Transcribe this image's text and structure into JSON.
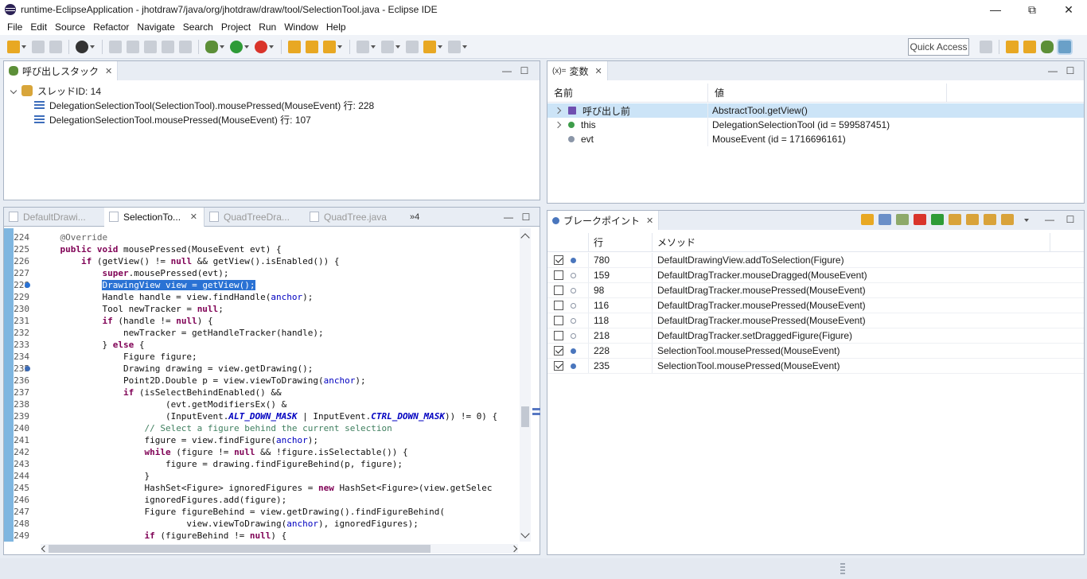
{
  "window": {
    "title": "runtime-EclipseApplication - jhotdraw7/java/org/jhotdraw/draw/tool/SelectionTool.java - Eclipse IDE",
    "minimize": "—",
    "maximize": "⧉",
    "close": "✕"
  },
  "menu": [
    "File",
    "Edit",
    "Source",
    "Refactor",
    "Navigate",
    "Search",
    "Project",
    "Run",
    "Window",
    "Help"
  ],
  "toolbar": {
    "quick_access": "Quick Access"
  },
  "debug_view": {
    "tab_label": "呼び出しスタック",
    "close": "✕",
    "minimize": "—",
    "maximize": "☐",
    "thread": "スレッドID: 14",
    "frames": [
      "DelegationSelectionTool(SelectionTool).mousePressed(MouseEvent) 行: 228",
      "DelegationSelectionTool.mousePressed(MouseEvent) 行: 107"
    ]
  },
  "variables_view": {
    "tab_label": "変数",
    "tab_prefix": "(x)=",
    "close": "✕",
    "minimize": "—",
    "maximize": "☐",
    "col_name": "名前",
    "col_value": "値",
    "rows": [
      {
        "name": "呼び出し前",
        "value": "AbstractTool.getView()",
        "icon": "return-icon",
        "expandable": true,
        "selected": true
      },
      {
        "name": "this",
        "value": "DelegationSelectionTool (id = 599587451)",
        "icon": "field-icon",
        "expandable": true,
        "selected": false
      },
      {
        "name": "evt",
        "value": "MouseEvent (id = 1716696161)",
        "icon": "local-icon",
        "expandable": false,
        "selected": false
      }
    ]
  },
  "editor": {
    "tabs": [
      {
        "label": "DefaultDrawi...",
        "active": false
      },
      {
        "label": "SelectionTo...",
        "active": true
      },
      {
        "label": "QuadTreeDra...",
        "active": false
      },
      {
        "label": "QuadTree.java",
        "active": false
      }
    ],
    "close": "✕",
    "overflow": "»4",
    "minimize": "—",
    "maximize": "☐",
    "lines": [
      {
        "n": "224",
        "html": "    <span class=\"an\">@Override</span>"
      },
      {
        "n": "225",
        "html": "    <span class=\"kw\">public</span> <span class=\"kw\">void</span> mousePressed(MouseEvent evt) {"
      },
      {
        "n": "226",
        "html": "        <span class=\"kw\">if</span> (getView() != <span class=\"kw\">null</span> &amp;&amp; getView().isEnabled()) {"
      },
      {
        "n": "227",
        "html": "            <span class=\"kw\">super</span>.mousePressed(evt);"
      },
      {
        "n": "228",
        "html": "            <span>DrawingView view = getView();</span>",
        "highlight": true,
        "bp": true
      },
      {
        "n": "229",
        "html": "            Handle handle = view.findHandle(<span class=\"fld\">anchor</span>);"
      },
      {
        "n": "230",
        "html": "            Tool newTracker = <span class=\"kw\">null</span>;"
      },
      {
        "n": "231",
        "html": "            <span class=\"kw\">if</span> (handle != <span class=\"kw\">null</span>) {"
      },
      {
        "n": "232",
        "html": "                newTracker = getHandleTracker(handle);"
      },
      {
        "n": "233",
        "html": "            } <span class=\"kw\">else</span> {"
      },
      {
        "n": "234",
        "html": "                Figure figure;"
      },
      {
        "n": "235",
        "html": "                Drawing drawing = view.getDrawing();",
        "bp": true
      },
      {
        "n": "236",
        "html": "                Point2D.Double p = view.viewToDrawing(<span class=\"fld\">anchor</span>);"
      },
      {
        "n": "237",
        "html": "                <span class=\"kw\">if</span> (isSelectBehindEnabled() &amp;&amp;"
      },
      {
        "n": "238",
        "html": "                        (evt.getModifiersEx() &amp;"
      },
      {
        "n": "239",
        "html": "                        (InputEvent.<span class=\"sfld\">ALT_DOWN_MASK</span> | InputEvent.<span class=\"sfld\">CTRL_DOWN_MASK</span>)) != 0) {"
      },
      {
        "n": "240",
        "html": "                    <span class=\"cm\">// Select a figure behind the current selection</span>"
      },
      {
        "n": "241",
        "html": "                    figure = view.findFigure(<span class=\"fld\">anchor</span>);"
      },
      {
        "n": "242",
        "html": "                    <span class=\"kw\">while</span> (figure != <span class=\"kw\">null</span> &amp;&amp; !figure.isSelectable()) {"
      },
      {
        "n": "243",
        "html": "                        figure = drawing.findFigureBehind(p, figure);"
      },
      {
        "n": "244",
        "html": "                    }"
      },
      {
        "n": "245",
        "html": "                    HashSet&lt;Figure&gt; ignoredFigures = <span class=\"kw\">new</span> HashSet&lt;Figure&gt;(view.getSelec"
      },
      {
        "n": "246",
        "html": "                    ignoredFigures.add(figure);"
      },
      {
        "n": "247",
        "html": "                    Figure figureBehind = view.getDrawing().findFigureBehind("
      },
      {
        "n": "248",
        "html": "                            view.viewToDrawing(<span class=\"fld\">anchor</span>), ignoredFigures);"
      },
      {
        "n": "249",
        "html": "                    <span class=\"kw\">if</span> (figureBehind != <span class=\"kw\">null</span>) {"
      }
    ]
  },
  "breakpoints_view": {
    "tab_label": "ブレークポイント",
    "close": "✕",
    "minimize": "—",
    "maximize": "☐",
    "col_line": "行",
    "col_method": "メソッド",
    "rows": [
      {
        "checked": true,
        "line": "780",
        "method": "DefaultDrawingView.addToSelection(Figure)"
      },
      {
        "checked": false,
        "line": "159",
        "method": "DefaultDragTracker.mouseDragged(MouseEvent)"
      },
      {
        "checked": false,
        "line": "98",
        "method": "DefaultDragTracker.mousePressed(MouseEvent)"
      },
      {
        "checked": false,
        "line": "116",
        "method": "DefaultDragTracker.mousePressed(MouseEvent)"
      },
      {
        "checked": false,
        "line": "118",
        "method": "DefaultDragTracker.mousePressed(MouseEvent)"
      },
      {
        "checked": false,
        "line": "218",
        "method": "DefaultDragTracker.setDraggedFigure(Figure)"
      },
      {
        "checked": true,
        "line": "228",
        "method": "SelectionTool.mousePressed(MouseEvent)"
      },
      {
        "checked": true,
        "line": "235",
        "method": "SelectionTool.mousePressed(MouseEvent)"
      }
    ]
  }
}
